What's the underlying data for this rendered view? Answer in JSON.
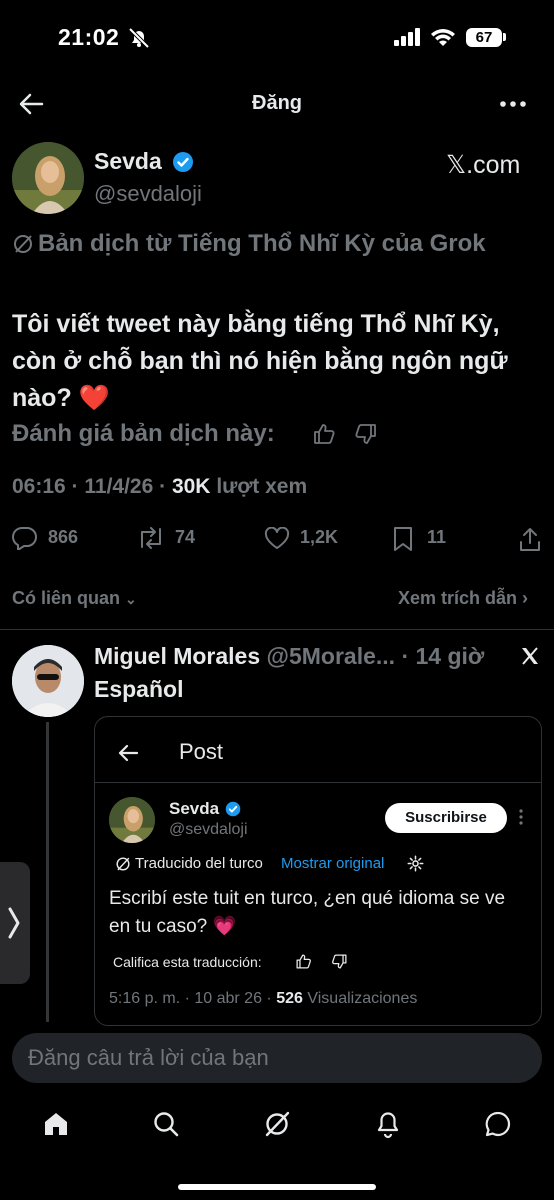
{
  "status_bar": {
    "time": "21:02",
    "battery": "67"
  },
  "nav": {
    "title": "Đăng"
  },
  "post": {
    "author_name": "Sevda",
    "author_handle": "@sevdaloji",
    "source_label": "𝕏.com",
    "translation_label": "Bản dịch từ Tiếng Thổ Nhĩ Kỳ của Grok",
    "text": "Tôi viết tweet này bằng tiếng Thổ Nhĩ Kỳ, còn ở chỗ bạn thì nó hiện bằng ngôn ngữ nào? ❤️",
    "rate_label": "Đánh giá bản dịch này:",
    "time": "06:16 · 11/4/26 · ",
    "views_count": "30K",
    "views_label": " lượt xem",
    "replies": "866",
    "reposts": "74",
    "likes": "1,2K",
    "bookmarks": "11"
  },
  "links": {
    "related": "Có liên quan",
    "quotes": "Xem trích dẫn"
  },
  "reply": {
    "name": "Miguel Morales",
    "meta": " @5Morale... · 14 giờ",
    "language": "Español",
    "card": {
      "header_title": "Post",
      "author_name": "Sevda",
      "author_handle": "@sevdaloji",
      "subscribe_label": "Suscribirse",
      "translated_label": "Traducido del turco",
      "show_original": "Mostrar original",
      "text": "Escribí este tuit en turco, ¿en qué idioma se ve en tu caso? 💗",
      "rate_label": "Califica esta traducción:",
      "meta_time": "5:16 p. m. · 10 abr 26 · ",
      "meta_views": "526",
      "meta_views_label": " Visualizaciones"
    }
  },
  "composer": {
    "placeholder": "Đăng câu trả lời của bạn"
  },
  "colors": {
    "background": "#000000",
    "text": "#e7e9ea",
    "muted": "#71767b",
    "verified": "#1d9bf0",
    "link": "#1d9bf0"
  }
}
